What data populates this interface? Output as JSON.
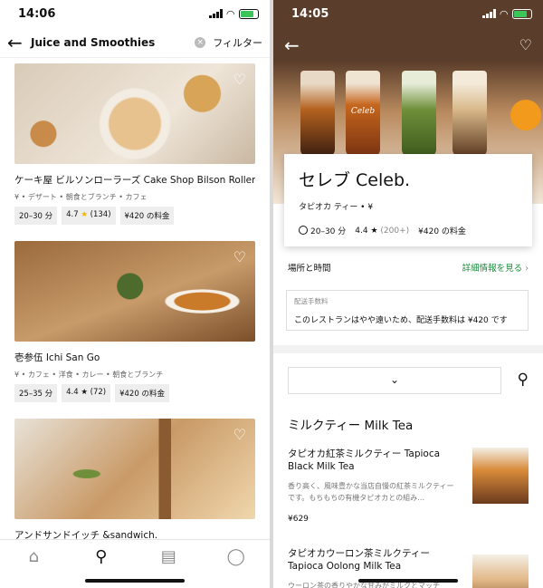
{
  "left": {
    "status": {
      "time": "14:06"
    },
    "search": {
      "query": "Juice and Smoothies",
      "clear_icon": "×",
      "filter_label": "フィルター"
    },
    "restaurants": [
      {
        "name": "ケーキ屋 ビルソンローラーズ Cake Shop Bilson Rollers",
        "tags": "¥ • デザート • 朝食とブランチ • カフェ",
        "time": "20–30 分",
        "rating": "4.7",
        "reviews": "(134)",
        "fee": "¥420 の料金"
      },
      {
        "name": "壱参伍 Ichi San Go",
        "tags": "¥ • カフェ • 洋食 • カレー • 朝食とブランチ",
        "time": "25–35 分",
        "rating": "4.4",
        "reviews": "(72)",
        "fee": "¥420 の料金"
      },
      {
        "name": "アンドサンドイッチ &sandwich.",
        "tags": "",
        "time": "",
        "rating": "",
        "reviews": "",
        "fee": ""
      }
    ],
    "tabs": [
      "store-icon",
      "search-icon",
      "orders-icon",
      "account-icon"
    ]
  },
  "right": {
    "status": {
      "time": "14:05"
    },
    "hero": {
      "cup_label": "Celeb"
    },
    "restaurant": {
      "title": "セレブ Celeb.",
      "sub": "タピオカ ティー • ¥",
      "time": "20–30 分",
      "rating": "4.4",
      "reviews": "(200+)",
      "fee": "¥420 の料金"
    },
    "location": {
      "label": "場所と時間",
      "link": "詳細情報を見る"
    },
    "fee_box": {
      "label": "配送手数料",
      "text": "このレストランはやや遠いため、配送手数料は ¥420 です"
    },
    "dropdown": {
      "chevron": "⌄"
    },
    "section_title": "ミルクティー  Milk Tea",
    "items": [
      {
        "name": "タピオカ紅茶ミルクティー Tapioca Black Milk Tea",
        "desc": "香り高く、風味豊かな当店自慢の紅茶ミルクティーです。もちもちの有機タピオカとの組み…",
        "price": "¥629"
      },
      {
        "name": "タピオカウーロン茶ミルクティー Tapioca Oolong Milk Tea",
        "desc": "ウーロン茶の香りやかな甘みがミルクとマッチ",
        "price": ""
      }
    ]
  }
}
